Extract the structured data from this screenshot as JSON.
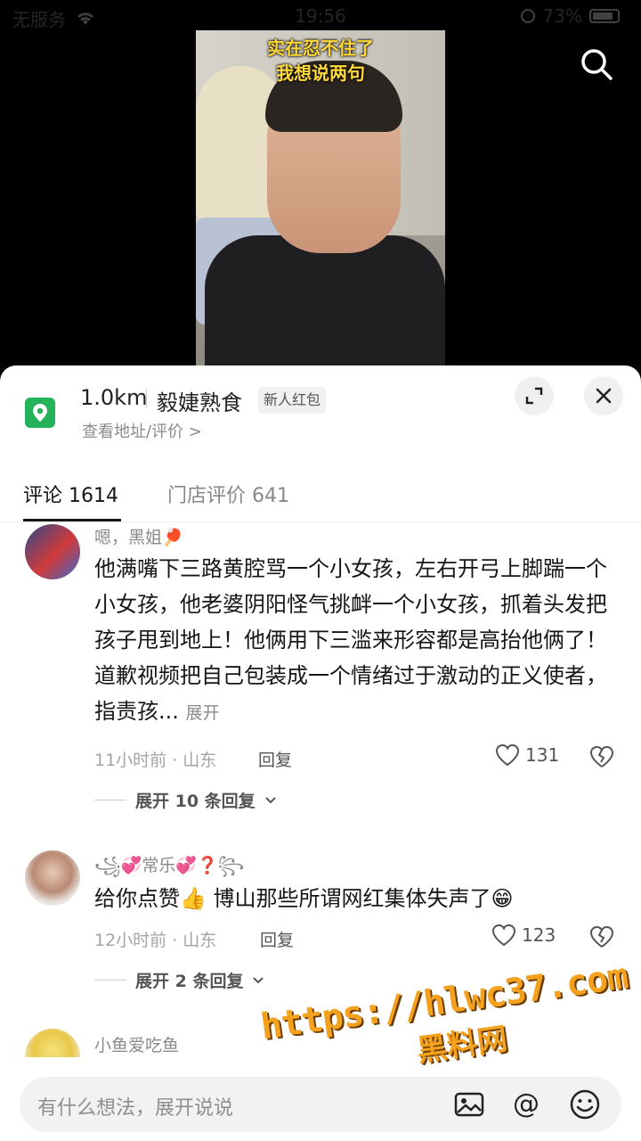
{
  "status_bar": {
    "carrier": "无服务",
    "time": "19:56",
    "battery": "73%"
  },
  "video": {
    "caption_line1": "实在忍不住了",
    "caption_line2": "我想说两句"
  },
  "store": {
    "distance": "1.0km",
    "name": "毅婕熟食",
    "badge": "新人红包",
    "link": "查看地址/评价 >"
  },
  "tabs": {
    "comments": "评论 1614",
    "reviews": "门店评价 641"
  },
  "comments": [
    {
      "username": "嗯，黑姐🏓",
      "text": "他满嘴下三路黄腔骂一个小女孩，左右开弓上脚踹一个小女孩，他老婆阴阳怪气挑衅一个小女孩，抓着头发把孩子甩到地上！他俩用下三滥来形容都是高抬他俩了！道歉视频把自己包装成一个情绪过于激动的正义使者，指责孩...",
      "more": "展开",
      "meta": "11小时前 · 山东",
      "reply": "回复",
      "likes": "131",
      "expand_replies": "展开 10 条回复"
    },
    {
      "username": "꧁💞常乐💞❓꧂",
      "text": "给你点赞👍 博山那些所谓网红集体失声了😁",
      "meta": "12小时前 · 山东",
      "reply": "回复",
      "likes": "123",
      "expand_replies": "展开 2 条回复"
    },
    {
      "username": "小鱼爱吃鱼"
    }
  ],
  "input": {
    "placeholder": "有什么想法，展开说说",
    "at_symbol": "@"
  },
  "watermark": {
    "url": "https://hlwc37.com",
    "title": "黑料网"
  },
  "colors": {
    "accent_green": "#24b35a",
    "caption_yellow": "#ffd83a",
    "watermark_orange": "#f4a21e"
  }
}
